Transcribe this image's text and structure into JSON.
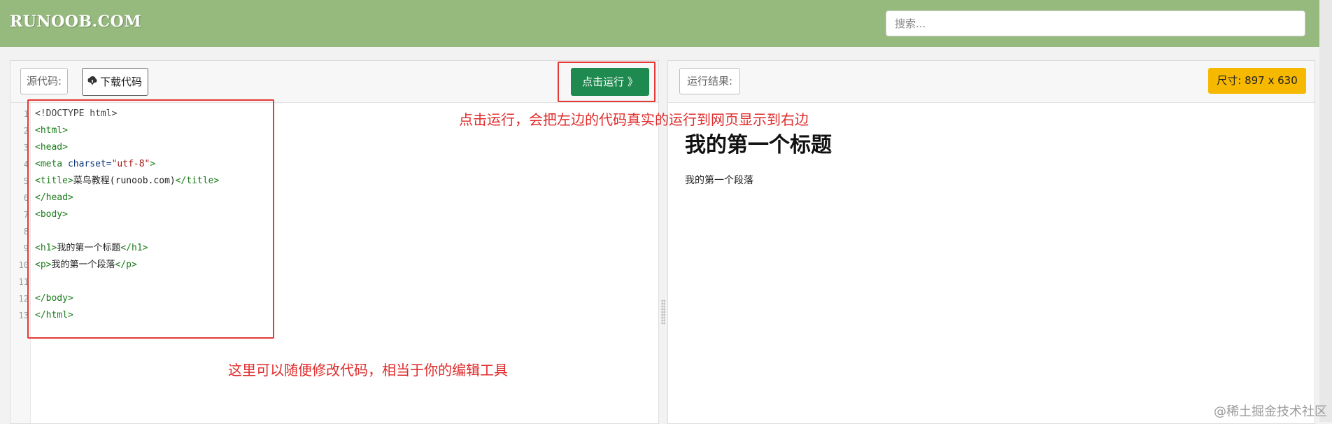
{
  "header": {
    "logo": "RUNOOB.COM",
    "search_placeholder": "搜索..."
  },
  "editor": {
    "source_label": "源代码:",
    "download_button": "下载代码",
    "run_button": "点击运行 》",
    "line_numbers": [
      "1",
      "2",
      "3",
      "4",
      "5",
      "6",
      "7",
      "8",
      "9",
      "10",
      "11",
      "12",
      "13"
    ]
  },
  "result": {
    "label": "运行结果:",
    "size_badge": "尺寸: 897 x 630",
    "heading": "我的第一个标题",
    "paragraph": "我的第一个段落"
  },
  "code": {
    "doctype": "<!DOCTYPE html>",
    "html_open": "<html>",
    "head_open": "<head>",
    "meta_tag": "<meta",
    "meta_attr": "charset=",
    "meta_val": "\"utf-8\"",
    "meta_close": ">",
    "title_open": "<title>",
    "title_text": "菜鸟教程(runoob.com)",
    "title_close": "</title>",
    "head_close": "</head>",
    "body_open": "<body>",
    "h1_open": "<h1>",
    "h1_text": "我的第一个标题",
    "h1_close": "</h1>",
    "p_open": "<p>",
    "p_text": "我的第一个段落",
    "p_close": "</p>",
    "body_close": "</body>",
    "html_close": "</html>"
  },
  "annotations": {
    "run_note": "点击运行，会把左边的代码真实的运行到网页显示到右边",
    "edit_note": "这里可以随便修改代码，相当于你的编辑工具",
    "color": "#e53935"
  },
  "watermark": "@稀土掘金技术社区",
  "colors": {
    "header_bg": "#96b97d",
    "run_button_bg": "#1e8a4f",
    "size_badge_bg": "#f7b800"
  }
}
